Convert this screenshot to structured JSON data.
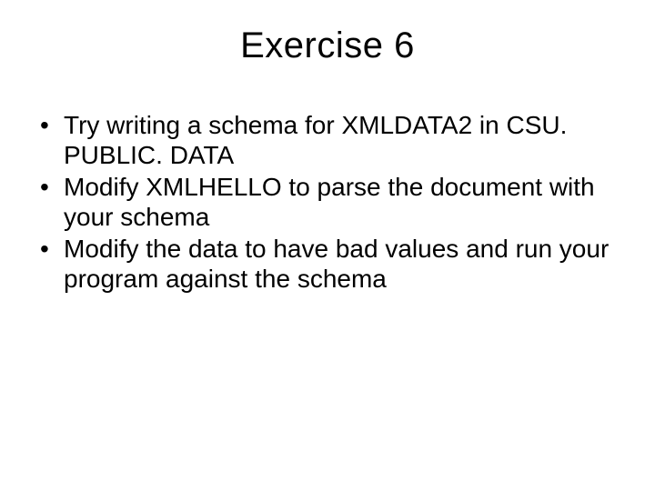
{
  "slide": {
    "title": "Exercise 6",
    "bullets": [
      "Try writing a schema for XMLDATA2 in CSU. PUBLIC. DATA",
      "Modify XMLHELLO to parse the document with your schema",
      "Modify the data to have bad values and run your program against the schema"
    ]
  }
}
